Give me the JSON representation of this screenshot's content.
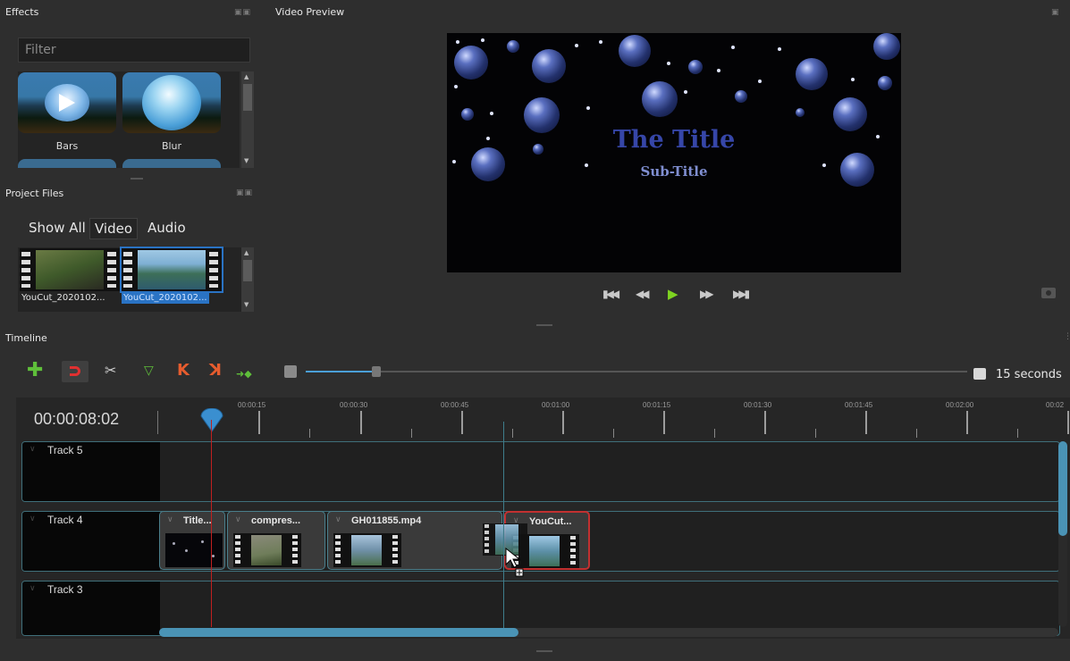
{
  "effects": {
    "title": "Effects",
    "filter_placeholder": "Filter",
    "items": [
      {
        "label": "Bars",
        "icon": "play-button-icon"
      },
      {
        "label": "Blur",
        "icon": "glass-sphere-icon"
      }
    ]
  },
  "project_files": {
    "title": "Project Files",
    "tabs": [
      "Show All",
      "Video",
      "Audio"
    ],
    "active_tab": "Video",
    "files": [
      {
        "label": "YouCut_2020102...",
        "selected": false
      },
      {
        "label": "YouCut_2020102...",
        "selected": true
      }
    ]
  },
  "preview": {
    "title": "Video Preview",
    "video_title": "The Title",
    "video_subtitle": "Sub-Title"
  },
  "timeline": {
    "title": "Timeline",
    "toolbar": {
      "icons": [
        "add-track-icon",
        "snap-magnet-icon",
        "razor-icon",
        "add-marker-icon",
        "previous-marker-icon",
        "next-marker-icon",
        "center-playhead-icon",
        "zoom-out-icon"
      ],
      "zoom_value": 0.1,
      "zoom_label": "15 seconds"
    },
    "timecode": "00:00:08:02",
    "ticks": [
      "00:00:15",
      "00:00:30",
      "00:00:45",
      "00:01:00",
      "00:01:15",
      "00:01:30",
      "00:01:45",
      "00:02:00",
      "00:02"
    ],
    "tracks": [
      {
        "name": "Track 5",
        "clips": []
      },
      {
        "name": "Track 4",
        "clips": [
          {
            "name": "Title...",
            "selected": false
          },
          {
            "name": "compres...",
            "selected": false
          },
          {
            "name": "GH011855.mp4",
            "selected": false
          },
          {
            "name": "YouCut...",
            "selected": true
          }
        ]
      },
      {
        "name": "Track 3",
        "clips": []
      }
    ],
    "horizontal_scroll": 0.4
  },
  "colors": {
    "accent": "#4a9fd8",
    "playhead": "#c02020",
    "selection": "#c23030",
    "add": "#5fbf3a"
  }
}
